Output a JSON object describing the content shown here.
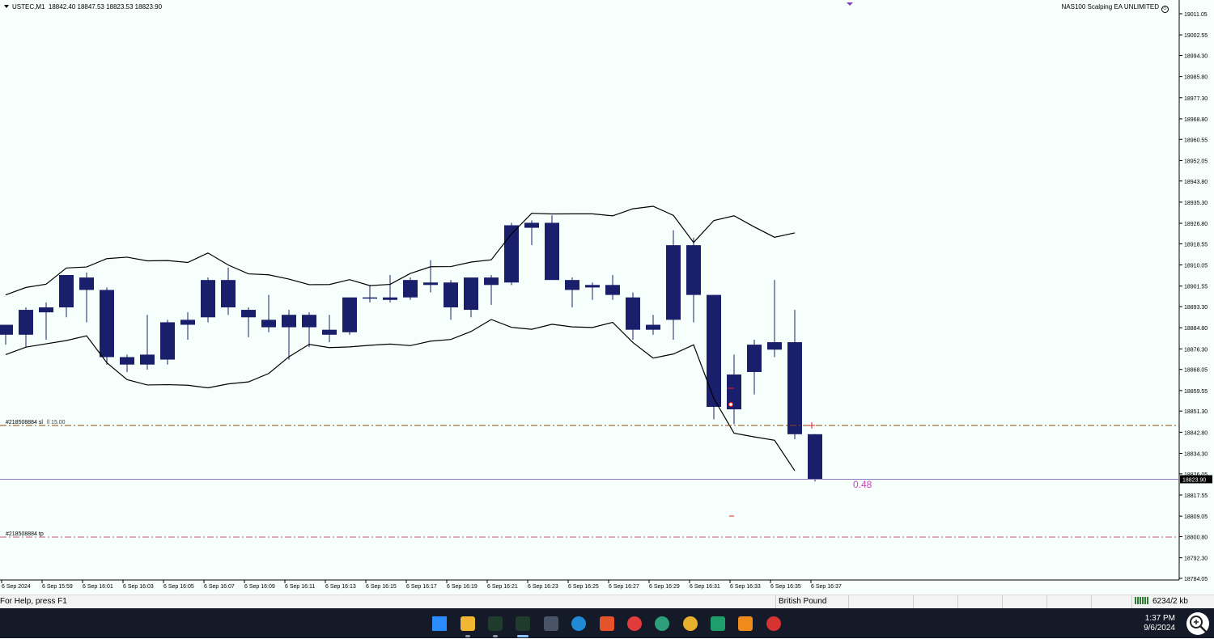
{
  "chart": {
    "symbol": "USTEC,M1",
    "ohlc": "18842.40 18847.53 18823.53 18823.90",
    "ea_name": "NAS100 Scalping EA UNLIMITED",
    "price_axis": [
      "19011.05",
      "19002.55",
      "18994.30",
      "18985.80",
      "18977.30",
      "18968.80",
      "18960.55",
      "18952.05",
      "18943.80",
      "18935.30",
      "18926.80",
      "18918.55",
      "18910.05",
      "18901.55",
      "18893.30",
      "18884.80",
      "18876.30",
      "18868.05",
      "18859.55",
      "18851.30",
      "18842.80",
      "18834.30",
      "18826.05",
      "18817.55",
      "18809.05",
      "18800.80",
      "18792.30",
      "18784.05"
    ],
    "time_axis": [
      "6 Sep 2024",
      "6 Sep 15:59",
      "6 Sep 16:01",
      "6 Sep 16:03",
      "6 Sep 16:05",
      "6 Sep 16:07",
      "6 Sep 16:09",
      "6 Sep 16:11",
      "6 Sep 16:13",
      "6 Sep 16:15",
      "6 Sep 16:17",
      "6 Sep 16:19",
      "6 Sep 16:21",
      "6 Sep 16:23",
      "6 Sep 16:25",
      "6 Sep 16:27",
      "6 Sep 16:29",
      "6 Sep 16:31",
      "6 Sep 16:33",
      "6 Sep 16:35",
      "6 Sep 16:37"
    ],
    "current_price": "18823.90",
    "sl_label": "#218508884 sl",
    "sl_extra": "ll 15.00",
    "tp_label": "#218508884 tp",
    "profit_text": "0.48",
    "colors": {
      "background": "#f6fffb",
      "candle": "#1a1f6b",
      "bands": "#000000",
      "sl_line": "#8b4a1a",
      "tp_line": "#c06060",
      "bid_line": "#8a7ac8",
      "profit": "#d040c0",
      "marker": "#8040c0"
    },
    "candles": [
      {
        "o": 18882,
        "h": 18884,
        "l": 18878,
        "c": 18886
      },
      {
        "o": 18882,
        "h": 18893,
        "l": 18877,
        "c": 18892
      },
      {
        "o": 18891,
        "h": 18895,
        "l": 18880,
        "c": 18893
      },
      {
        "o": 18893,
        "h": 18906,
        "l": 18889,
        "c": 18906
      },
      {
        "o": 18905,
        "h": 18907,
        "l": 18887,
        "c": 18900
      },
      {
        "o": 18900,
        "h": 18901,
        "l": 18870,
        "c": 18873
      },
      {
        "o": 18873,
        "h": 18874,
        "l": 18867,
        "c": 18870
      },
      {
        "o": 18870,
        "h": 18890,
        "l": 18868,
        "c": 18874
      },
      {
        "o": 18872,
        "h": 18888,
        "l": 18870,
        "c": 18887
      },
      {
        "o": 18886,
        "h": 18891,
        "l": 18880,
        "c": 18888
      },
      {
        "o": 18889,
        "h": 18905,
        "l": 18887,
        "c": 18904
      },
      {
        "o": 18904,
        "h": 18909,
        "l": 18890,
        "c": 18893
      },
      {
        "o": 18892,
        "h": 18893,
        "l": 18881,
        "c": 18889
      },
      {
        "o": 18888,
        "h": 18898,
        "l": 18883,
        "c": 18885
      },
      {
        "o": 18885,
        "h": 18892,
        "l": 18872,
        "c": 18890
      },
      {
        "o": 18890,
        "h": 18891,
        "l": 18877,
        "c": 18885
      },
      {
        "o": 18884,
        "h": 18890,
        "l": 18879,
        "c": 18882
      },
      {
        "o": 18883,
        "h": 18897,
        "l": 18882,
        "c": 18897
      },
      {
        "o": 18897,
        "h": 18902,
        "l": 18895,
        "c": 18897
      },
      {
        "o": 18896,
        "h": 18906,
        "l": 18895,
        "c": 18897
      },
      {
        "o": 18897,
        "h": 18905,
        "l": 18896,
        "c": 18904
      },
      {
        "o": 18902,
        "h": 18912,
        "l": 18899,
        "c": 18903
      },
      {
        "o": 18903,
        "h": 18904,
        "l": 18888,
        "c": 18893
      },
      {
        "o": 18892,
        "h": 18905,
        "l": 18889,
        "c": 18905
      },
      {
        "o": 18902,
        "h": 18906,
        "l": 18894,
        "c": 18905
      },
      {
        "o": 18903,
        "h": 18927,
        "l": 18902,
        "c": 18926
      },
      {
        "o": 18925,
        "h": 18928,
        "l": 18918,
        "c": 18927
      },
      {
        "o": 18927,
        "h": 18930,
        "l": 18904,
        "c": 18904
      },
      {
        "o": 18904,
        "h": 18905,
        "l": 18893,
        "c": 18900
      },
      {
        "o": 18901,
        "h": 18903,
        "l": 18896,
        "c": 18902
      },
      {
        "o": 18902,
        "h": 18906,
        "l": 18896,
        "c": 18898
      },
      {
        "o": 18897,
        "h": 18899,
        "l": 18880,
        "c": 18884
      },
      {
        "o": 18886,
        "h": 18890,
        "l": 18882,
        "c": 18884
      },
      {
        "o": 18888,
        "h": 18924,
        "l": 18880,
        "c": 18918
      },
      {
        "o": 18918,
        "h": 18921,
        "l": 18887,
        "c": 18898
      },
      {
        "o": 18898,
        "h": 18898,
        "l": 18848,
        "c": 18853
      },
      {
        "o": 18866,
        "h": 18874,
        "l": 18846,
        "c": 18852
      },
      {
        "o": 18867,
        "h": 18880,
        "l": 18858,
        "c": 18878
      },
      {
        "o": 18879,
        "h": 18904,
        "l": 18873,
        "c": 18876
      },
      {
        "o": 18879,
        "h": 18892,
        "l": 18840,
        "c": 18842
      },
      {
        "o": 18842,
        "h": 18842,
        "l": 18823,
        "c": 18824
      }
    ]
  },
  "status_bar": {
    "help": "For Help, press F1",
    "account": "British Pound",
    "traffic": "6234/2 kb"
  },
  "taskbar": {
    "time": "1:37 PM",
    "date": "9/6/2024",
    "icons": [
      {
        "name": "windows-start-icon",
        "color": "#2b8cff"
      },
      {
        "name": "file-explorer-icon",
        "color": "#f2b632"
      },
      {
        "name": "metatrader-icon",
        "color": "#1f3b2c"
      },
      {
        "name": "metatrader-active-icon",
        "color": "#1f3b2c"
      },
      {
        "name": "app-shield-icon",
        "color": "#4a5468"
      },
      {
        "name": "edge-icon",
        "color": "#1f8bd6"
      },
      {
        "name": "ninjatrader-icon",
        "color": "#e4532a"
      },
      {
        "name": "app-red-icon",
        "color": "#e23b3b"
      },
      {
        "name": "app-globe-icon",
        "color": "#2f9e7a"
      },
      {
        "name": "chrome-icon",
        "color": "#e8b12b"
      },
      {
        "name": "chart-app-icon",
        "color": "#1e9e6a"
      },
      {
        "name": "vlc-icon",
        "color": "#f08a1b"
      },
      {
        "name": "recorder-icon",
        "color": "#d63333"
      }
    ]
  }
}
